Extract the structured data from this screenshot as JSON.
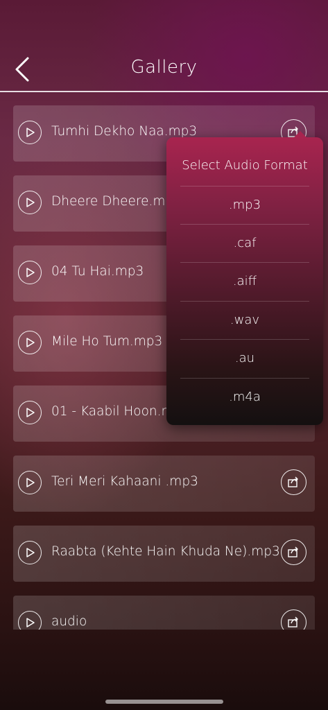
{
  "header": {
    "title": "Gallery"
  },
  "files": [
    {
      "label": "Tumhi Dekho Naa.mp3"
    },
    {
      "label": "Dheere Dheere.mp3"
    },
    {
      "label": "04 Tu Hai.mp3"
    },
    {
      "label": "Mile Ho Tum.mp3"
    },
    {
      "label": "01 - Kaabil Hoon.mp3"
    },
    {
      "label": "Teri Meri Kahaani .mp3"
    },
    {
      "label": "Raabta (Kehte Hain Khuda Ne).mp3"
    },
    {
      "label": "audio"
    }
  ],
  "popup": {
    "title": "Select Audio Format",
    "options": [
      ".mp3",
      ".caf",
      ".aiff",
      ".wav",
      ".au",
      ".m4a"
    ]
  },
  "icons": {
    "back": "chevron-left-icon",
    "play": "play-icon",
    "share": "share-icon"
  }
}
